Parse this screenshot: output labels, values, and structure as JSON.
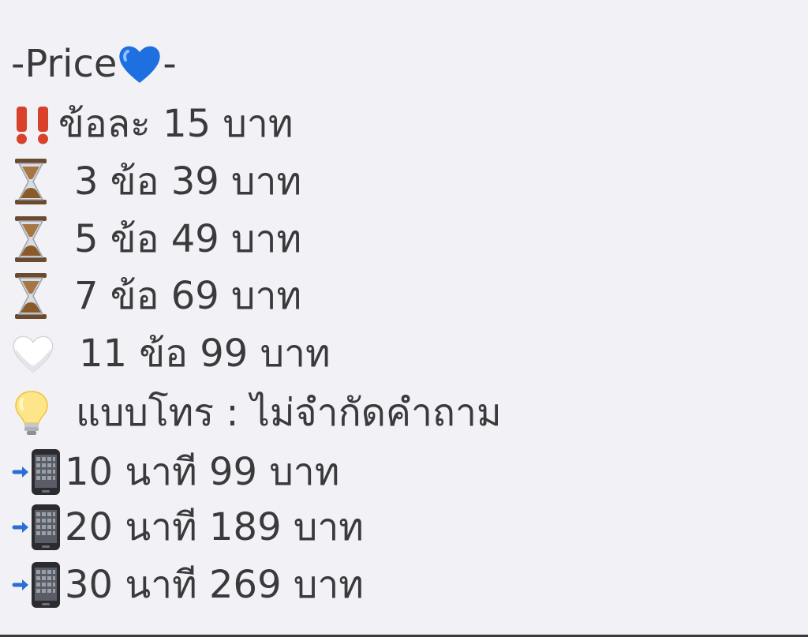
{
  "title": {
    "prefix": "-Price",
    "suffix": "-",
    "icon": "blue-heart-icon",
    "heart_color": "#1e6fe0"
  },
  "items": [
    {
      "icon": "double-exclamation-icon",
      "text": "ข้อละ 15 บาท"
    },
    {
      "icon": "hourglass-icon",
      "text": "3 ข้อ 39 บาท"
    },
    {
      "icon": "hourglass-icon",
      "text": "5 ข้อ 49 บาท"
    },
    {
      "icon": "hourglass-icon",
      "text": "7 ข้อ 69 บาท"
    },
    {
      "icon": "white-heart-icon",
      "text": "11 ข้อ 99 บาท"
    },
    {
      "icon": "light-bulb-icon",
      "text": "แบบโทร : ไม่จำกัดคำถาม"
    },
    {
      "icon": "phone-arrow-icon",
      "text": "10 นาที 99 บาท"
    },
    {
      "icon": "phone-arrow-icon",
      "text": "20 นาที 189 บาท"
    },
    {
      "icon": "phone-arrow-icon",
      "text": "30 นาที 269 บาท"
    }
  ],
  "colors": {
    "background": "#f2f2f6",
    "text": "#3a3a3d",
    "exclamation": "#d8412a",
    "hourglass_sand": "#8a5a2b",
    "arrow": "#2b6fd6"
  }
}
